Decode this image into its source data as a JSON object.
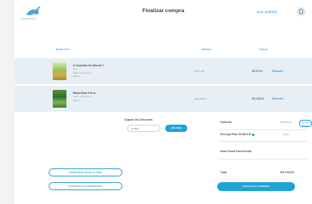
{
  "header": {
    "logo_text": "GIRAFINHA",
    "title": "Finalizar compra",
    "user_link": "OLÁ, ACESSE"
  },
  "table": {
    "headers": {
      "product": "PRODUTO",
      "price": "PREÇO",
      "total": "TOTAL"
    },
    "rows": [
      {
        "name": "O Caminho Do Mundo 7",
        "line1": "Ano",
        "line2": "Autor: Lorem ipsum",
        "line3": "Qtde: 1",
        "price": "R$ 97,00",
        "total": "R$ 97,00",
        "remove": "Remover"
      },
      {
        "name": "Maravilhas 9 Ano",
        "line1": "Autor: Lorem ipsum",
        "line2": "Qtde: 1",
        "line3": "",
        "price": "R$ 128,00",
        "total": "R$ 128,00",
        "remove": "Remover"
      }
    ]
  },
  "coupon": {
    "label": "Cupom De Desconto",
    "placeholder": "Código",
    "button": "APLICAR"
  },
  "summary": {
    "subtotal_label": "Subtotal",
    "subtotal_value": "R$ 225,00",
    "delivery_label": "Entrega Para 01136-010",
    "delivery_value": "Grátis",
    "help_badge": "PRECISA DE AJUDA?",
    "note_label": "Nota Fiscal Para Escola",
    "total_label": "Total",
    "total_value": "R$ 225,00"
  },
  "buttons": {
    "add_school": "ADICIONAR MAIS ALUNO",
    "continue": "CONTINUAR COMPRANDO",
    "checkout": "FINALIZAR COMPRA"
  },
  "colors": {
    "accent": "#1fa4d8",
    "row_bg": "#e7eef4"
  }
}
